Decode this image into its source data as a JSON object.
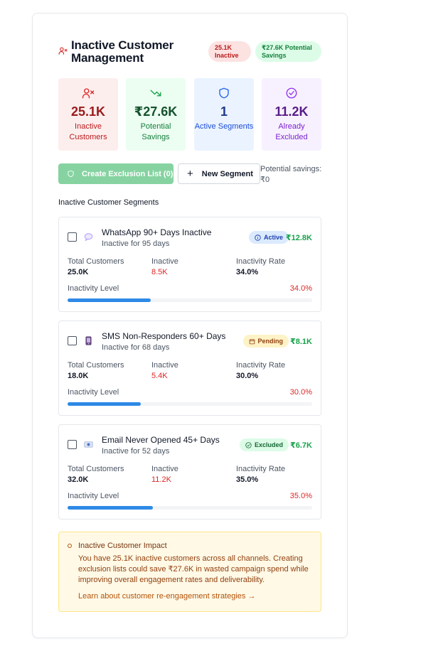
{
  "header": {
    "title": "Inactive Customer Management",
    "badge_inactive": "25.1K Inactive",
    "badge_savings": "₹27.6K Potential Savings",
    "icon": "user-x-icon"
  },
  "stats": [
    {
      "value": "25.1K",
      "label": "Inactive Customers",
      "icon": "user-x-icon",
      "color": "#dc2626"
    },
    {
      "value": "₹27.6K",
      "label": "Potential Savings",
      "icon": "trending-down-icon",
      "color": "#16a34a"
    },
    {
      "value": "1",
      "label": "Active Segments",
      "icon": "shield-icon",
      "color": "#2563eb"
    },
    {
      "value": "11.2K",
      "label": "Already Excluded",
      "icon": "check-circle-icon",
      "color": "#9333ea"
    }
  ],
  "actions": {
    "create_label": "Create Exclusion List (0)",
    "new_segment_label": "New Segment",
    "potential_savings": "Potential savings: ₹0"
  },
  "segments_title": "Inactive Customer Segments",
  "segments": [
    {
      "name": "WhatsApp 90+ Days Inactive",
      "subtitle": "Inactive for 95 days",
      "status": "Active",
      "amount": "₹12.8K",
      "total_label": "Total Customers",
      "total": "25.0K",
      "inactive_label": "Inactive",
      "inactive": "8.5K",
      "rate_label": "Inactivity Rate",
      "rate": "34.0%",
      "level_label": "Inactivity Level",
      "level_text": "34.0%",
      "level": 0.34,
      "channel_icon": "speech-bubble-icon"
    },
    {
      "name": "SMS Non-Responders 60+ Days",
      "subtitle": "Inactive for 68 days",
      "status": "Pending",
      "amount": "₹8.1K",
      "total_label": "Total Customers",
      "total": "18.0K",
      "inactive_label": "Inactive",
      "inactive": "5.4K",
      "rate_label": "Inactivity Rate",
      "rate": "30.0%",
      "level_label": "Inactivity Level",
      "level_text": "30.0%",
      "level": 0.3,
      "channel_icon": "mobile-phone-icon"
    },
    {
      "name": "Email Never Opened 45+ Days",
      "subtitle": "Inactive for 52 days",
      "status": "Excluded",
      "amount": "₹6.7K",
      "total_label": "Total Customers",
      "total": "32.0K",
      "inactive_label": "Inactive",
      "inactive": "11.2K",
      "rate_label": "Inactivity Rate",
      "rate": "35.0%",
      "level_label": "Inactivity Level",
      "level_text": "35.0%",
      "level": 0.35,
      "channel_icon": "email-icon"
    }
  ],
  "impact": {
    "title": "Inactive Customer Impact",
    "description": "You have 25.1K inactive customers across all channels. Creating exclusion lists could save ₹27.6K in wasted campaign spend while improving overall engagement rates and deliverability.",
    "link": "Learn about customer re-engagement strategies →"
  }
}
